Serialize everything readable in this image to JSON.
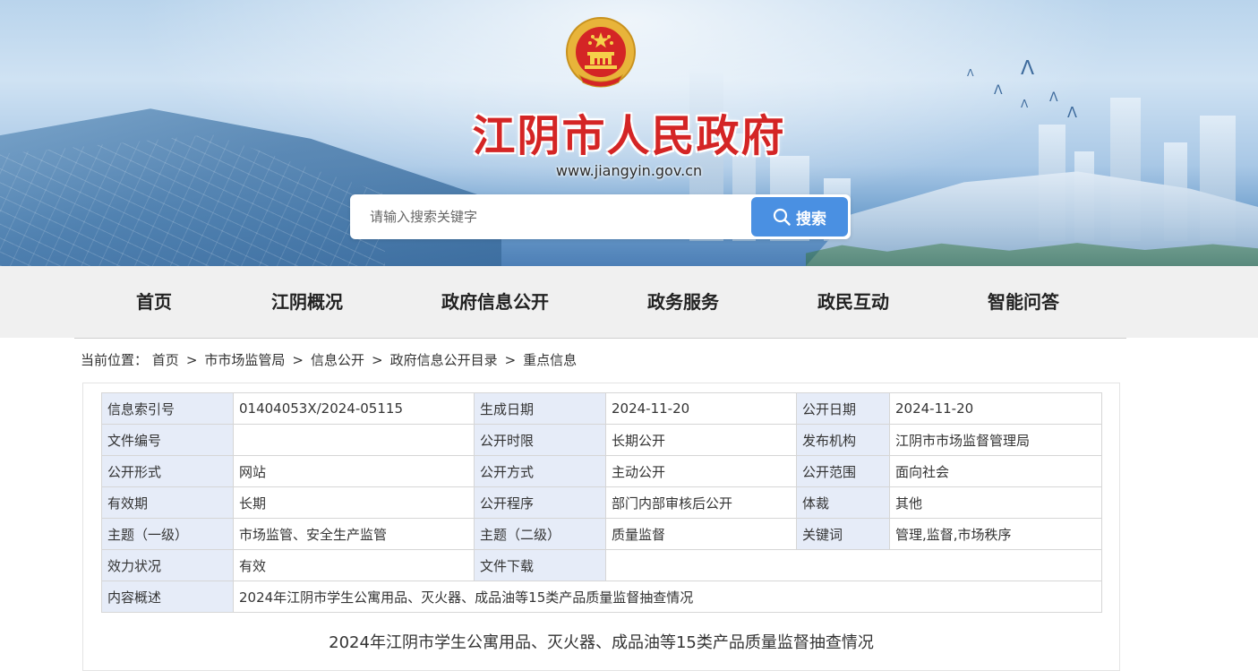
{
  "header": {
    "site_title": "江阴市人民政府",
    "site_url": "www.jiangyin.gov.cn",
    "search": {
      "placeholder": "请输入搜索关键字",
      "button_label": "搜索"
    },
    "colors": {
      "title": "#d42525",
      "search_button": "#4a90e2"
    },
    "emblem_icon": "national-emblem-icon"
  },
  "nav": {
    "items": [
      {
        "label": "首页"
      },
      {
        "label": "江阴概况"
      },
      {
        "label": "政府信息公开"
      },
      {
        "label": "政务服务"
      },
      {
        "label": "政民互动"
      },
      {
        "label": "智能问答"
      }
    ]
  },
  "breadcrumb": {
    "prefix": "当前位置：",
    "separator": ">",
    "items": [
      "首页",
      "市市场监管局",
      "信息公开",
      "政府信息公开目录",
      "重点信息"
    ]
  },
  "info_table": {
    "rows": [
      [
        {
          "label": "信息索引号",
          "value": "01404053X/2024-05115"
        },
        {
          "label": "生成日期",
          "value": "2024-11-20"
        },
        {
          "label": "公开日期",
          "value": "2024-11-20"
        }
      ],
      [
        {
          "label": "文件编号",
          "value": ""
        },
        {
          "label": "公开时限",
          "value": "长期公开"
        },
        {
          "label": "发布机构",
          "value": "江阴市市场监督管理局"
        }
      ],
      [
        {
          "label": "公开形式",
          "value": "网站"
        },
        {
          "label": "公开方式",
          "value": "主动公开"
        },
        {
          "label": "公开范围",
          "value": "面向社会"
        }
      ],
      [
        {
          "label": "有效期",
          "value": "长期"
        },
        {
          "label": "公开程序",
          "value": "部门内部审核后公开"
        },
        {
          "label": "体裁",
          "value": "其他"
        }
      ],
      [
        {
          "label": "主题（一级）",
          "value": "市场监管、安全生产监管"
        },
        {
          "label": "主题（二级）",
          "value": "质量监督"
        },
        {
          "label": "关键词",
          "value": "管理,监督,市场秩序"
        }
      ]
    ],
    "row6": {
      "label1": "效力状况",
      "value1": "有效",
      "label2": "文件下载",
      "value2": ""
    },
    "summary": {
      "label": "内容概述",
      "value": "2024年江阴市学生公寓用品、灭火器、成品油等15类产品质量监督抽查情况"
    }
  },
  "article": {
    "title": "2024年江阴市学生公寓用品、灭火器、成品油等15类产品质量监督抽查情况"
  }
}
